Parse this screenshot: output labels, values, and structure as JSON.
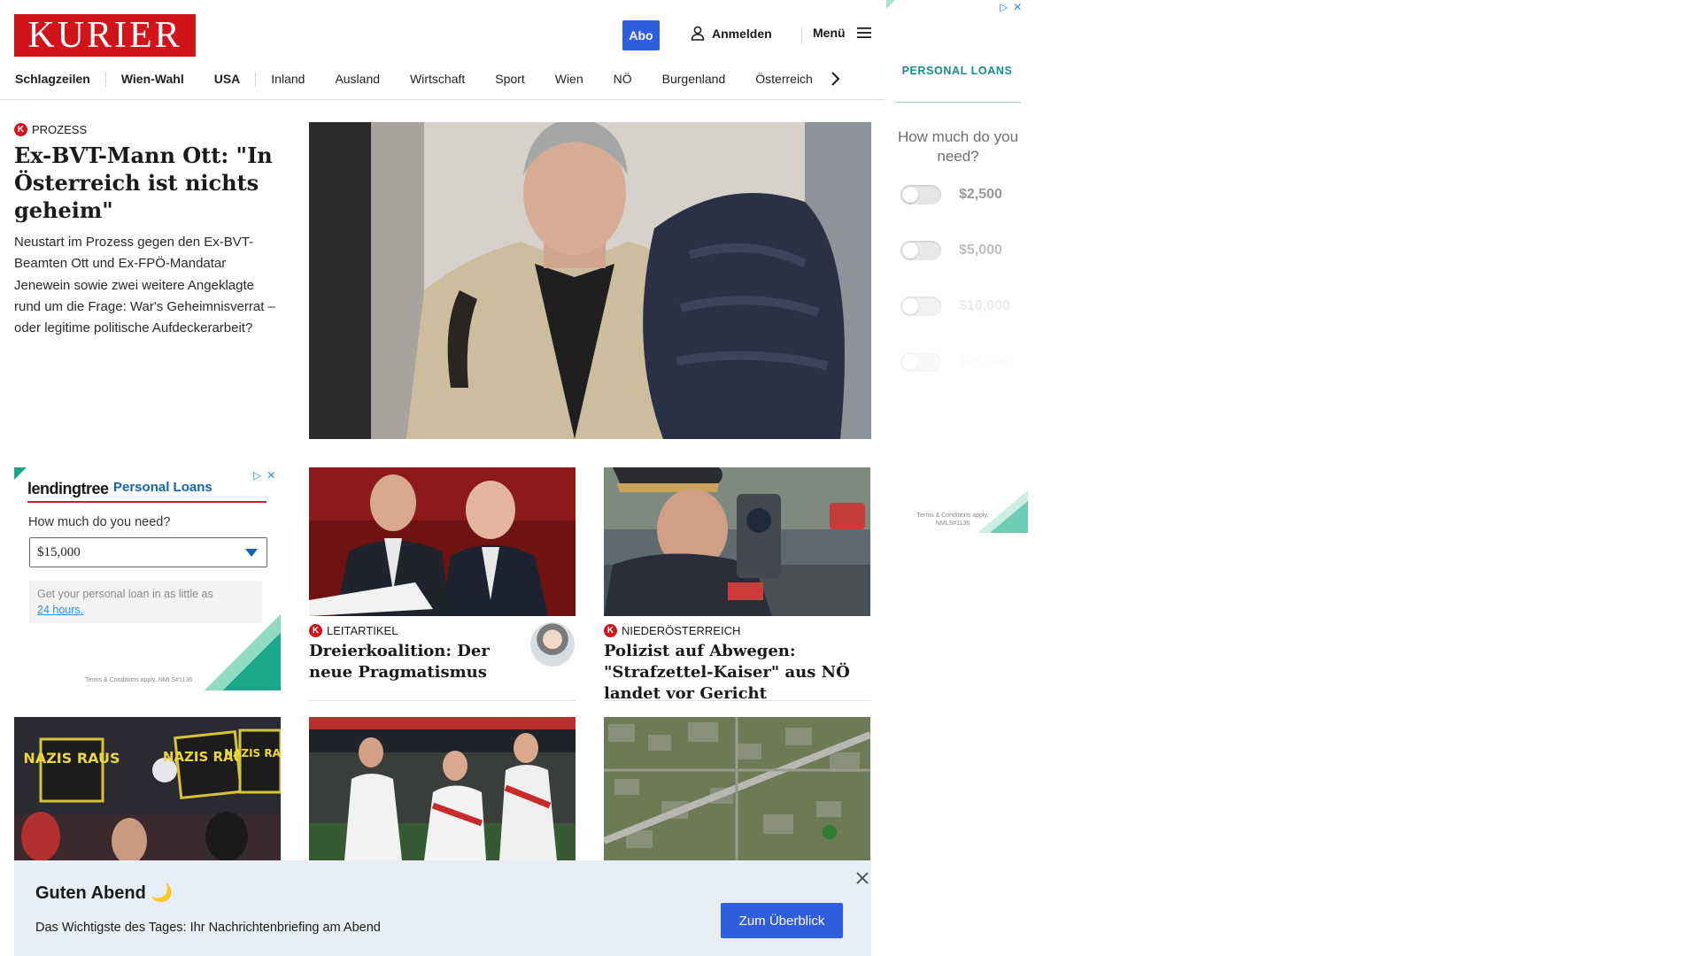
{
  "header": {
    "logo": "KURIER",
    "abo_label": "Abo",
    "login_label": "Anmelden",
    "menu_label": "Menü"
  },
  "nav": {
    "items": [
      "Schlagzeilen",
      "Wien-Wahl",
      "USA",
      "Inland",
      "Ausland",
      "Wirtschaft",
      "Sport",
      "Wien",
      "NÖ",
      "Burgenland",
      "Österreich"
    ]
  },
  "hero": {
    "kicker": "PROZESS",
    "title": "Ex-BVT-Mann Ott: \"In Österreich ist nichts geheim\"",
    "teaser": "Neustart im Prozess gegen den Ex-BVT-Beamten Ott und Ex-FPÖ-Mandatar Jenewein sowie zwei weitere Angeklagte rund um die Frage: War's Geheimnisverrat – oder legitime politische Aufdeckerarbeit?"
  },
  "ad_lendingtree": {
    "logo": "lendingtree",
    "product": "Personal Loans",
    "question": "How much do you need?",
    "selected_amount": "$15,000",
    "note_prefix": "Get your personal loan in as little as",
    "note_link": "24 hours.",
    "terms": "Terms & Conditions apply. NMLS#1136"
  },
  "cards": [
    {
      "kicker": "LEITARTIKEL",
      "title": "Dreierkoalition: Der neue Pragmatismus"
    },
    {
      "kicker": "NIEDERÖSTERREICH",
      "title": "Polizist auf Abwegen: \"Strafzettel-Kaiser\" aus NÖ landet vor Gericht"
    }
  ],
  "protest_signs": [
    "NAZIS RAUS",
    "NAZIS RAUS",
    "NAZIS RAUS"
  ],
  "briefing": {
    "title": "Guten Abend 🌙",
    "text": "Das Wichtigste des Tages: Ihr Nachrichtenbriefing am Abend",
    "button_label": "Zum Überblick"
  },
  "ad_right": {
    "heading": "PERSONAL LOANS",
    "question": "How much do you need?",
    "options": [
      "$2,500",
      "$5,000",
      "$10,000",
      "$25,000"
    ],
    "terms": "Terms & Conditions apply. NMLS#1136"
  },
  "colors": {
    "brand_red": "#d1131c",
    "button_blue": "#2f5ddf",
    "briefing_bg": "#e8eef7",
    "ad_teal": "#1c8c87",
    "ad_option_text": [
      "#999999",
      "#b4b4b4",
      "#dcdcdc",
      "#f0f0f0"
    ]
  }
}
